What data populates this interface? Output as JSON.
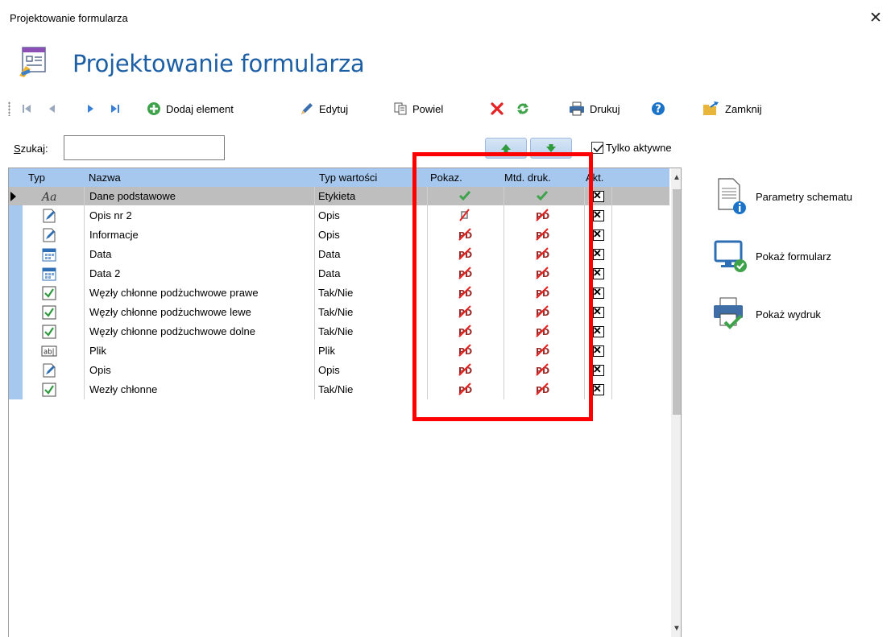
{
  "window": {
    "title": "Projektowanie formularza",
    "close_glyph": "✕"
  },
  "header": {
    "title": "Projektowanie formularza",
    "icon": "form-designer-icon"
  },
  "toolbar": {
    "nav_icons": [
      "first-record-icon",
      "prev-record-icon",
      "next-record-icon",
      "last-record-icon"
    ],
    "add_label": "Dodaj element",
    "edit_label": "Edytuj",
    "copy_label": "Powiel",
    "print_label": "Drukuj",
    "close_label": "Zamknij"
  },
  "search": {
    "label": "Szukaj:",
    "value": "",
    "placeholder": ""
  },
  "filter": {
    "active_only_label": "Tylko aktywne",
    "active_only_checked": true
  },
  "grid": {
    "headers": {
      "type": "Typ",
      "name": "Nazwa",
      "value_type": "Typ wartości",
      "show": "Pokaz.",
      "print_method": "Mtd. druk.",
      "active": "Akt."
    },
    "rows": [
      {
        "icon": "label-icon",
        "name": "Dane podstawowe",
        "value_type": "Etykieta",
        "show": "check",
        "print": "check",
        "active": true,
        "selected": true
      },
      {
        "icon": "description-icon",
        "name": "Opis nr 2",
        "value_type": "Opis",
        "show": "crossed-small",
        "print": "crossed-pdf",
        "active": true
      },
      {
        "icon": "description-icon",
        "name": "Informacje",
        "value_type": "Opis",
        "show": "crossed-pdf",
        "print": "crossed-pdf",
        "active": true
      },
      {
        "icon": "calendar-icon",
        "name": "Data",
        "value_type": "Data",
        "show": "crossed-pdf",
        "print": "crossed-pdf",
        "active": true
      },
      {
        "icon": "calendar-icon",
        "name": "Data 2",
        "value_type": "Data",
        "show": "crossed-pdf",
        "print": "crossed-pdf",
        "active": true
      },
      {
        "icon": "checkbox-icon",
        "name": "Węzły chłonne podżuchwowe prawe",
        "value_type": "Tak/Nie",
        "show": "crossed-pdf",
        "print": "crossed-pdf",
        "active": true
      },
      {
        "icon": "checkbox-icon",
        "name": "Węzły chłonne podżuchwowe lewe",
        "value_type": "Tak/Nie",
        "show": "crossed-pdf",
        "print": "crossed-pdf",
        "active": true
      },
      {
        "icon": "checkbox-icon",
        "name": "Węzły chłonne podżuchwowe dolne",
        "value_type": "Tak/Nie",
        "show": "crossed-pdf",
        "print": "crossed-pdf",
        "active": true
      },
      {
        "icon": "file-field-icon",
        "name": "Plik",
        "value_type": "Plik",
        "show": "crossed-pdf",
        "print": "crossed-pdf",
        "active": true
      },
      {
        "icon": "description-icon",
        "name": "Opis",
        "value_type": "Opis",
        "show": "crossed-pdf",
        "print": "crossed-pdf",
        "active": true
      },
      {
        "icon": "checkbox-icon",
        "name": "Wezły chłonne",
        "value_type": "Tak/Nie",
        "show": "crossed-pdf",
        "print": "crossed-pdf",
        "active": true
      }
    ]
  },
  "side": {
    "schema_params_label": "Parametry schematu",
    "show_form_label": "Pokaż formularz",
    "show_print_label": "Pokaż wydruk"
  },
  "colors": {
    "header_title": "#1d5fa5",
    "grid_header": "#a6c8ef",
    "highlight": "#ff0000",
    "check_green": "#3fa34d",
    "cross_red": "#e52222"
  }
}
